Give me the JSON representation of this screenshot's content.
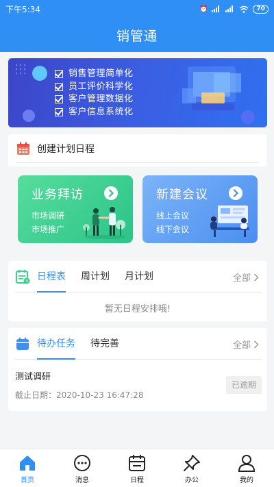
{
  "status_bar": {
    "time": "下午5:34",
    "battery": "70"
  },
  "app_bar": {
    "title": "销管通"
  },
  "banner": {
    "items": [
      "销售管理简单化",
      "员工评价科学化",
      "客户管理数据化",
      "客户信息系统化"
    ]
  },
  "create_schedule": {
    "label": "创建计划日程"
  },
  "tiles": [
    {
      "title": "业务拜访",
      "lines": [
        "市场调研",
        "市场推广"
      ]
    },
    {
      "title": "新建会议",
      "lines": [
        "线上会议",
        "线下会议"
      ]
    }
  ],
  "schedule": {
    "tabs": [
      "日程表",
      "周计划",
      "月计划"
    ],
    "active_tab": "日程表",
    "all_label": "全部",
    "empty_text": "暂无日程安排哦!"
  },
  "tasks": {
    "tabs": [
      "待办任务",
      "待完善"
    ],
    "active_tab": "待办任务",
    "all_label": "全部",
    "item": {
      "title": "测试调研",
      "due": "截止日期：2020-10-23 16:47:28",
      "status": "已逾期"
    }
  },
  "tab_bar": {
    "items": [
      {
        "label": "首页",
        "icon": "home-icon"
      },
      {
        "label": "消息",
        "icon": "message-icon"
      },
      {
        "label": "日程",
        "icon": "calendar-icon"
      },
      {
        "label": "办公",
        "icon": "pin-icon"
      },
      {
        "label": "我的",
        "icon": "user-icon"
      }
    ],
    "active": "首页"
  },
  "colors": {
    "primary": "#2f8ff4",
    "green_tile": "#2cc389",
    "blue_tile": "#4a8ef0",
    "overdue_bg": "#f0f0f0"
  }
}
